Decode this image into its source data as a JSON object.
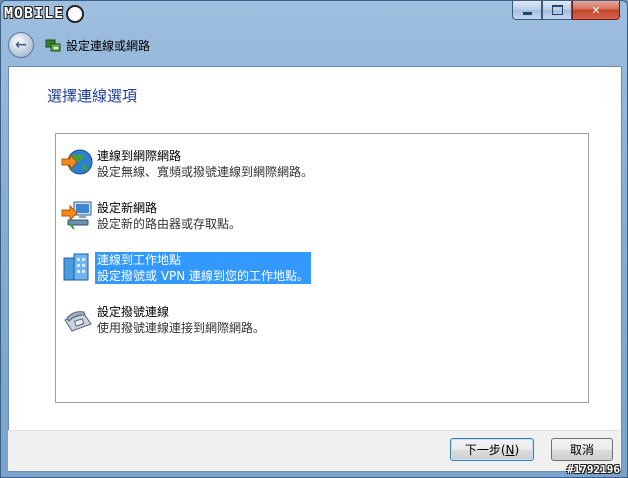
{
  "watermark": {
    "text": "MOBILE",
    "tag": "#1792196"
  },
  "window": {
    "title": "設定連線或網路",
    "controls": {
      "minimize": "minimize",
      "maximize": "maximize",
      "close": "✕"
    }
  },
  "page": {
    "heading": "選擇連線選項"
  },
  "options": [
    {
      "title": "連線到網際網路",
      "desc": "設定無線、寬頻或撥號連線到網際網路。",
      "icon": "globe-connect-icon",
      "selected": false
    },
    {
      "title": "設定新網路",
      "desc": "設定新的路由器或存取點。",
      "icon": "new-network-icon",
      "selected": false
    },
    {
      "title": "連線到工作地點",
      "desc": "設定撥號或 VPN 連線到您的工作地點。",
      "icon": "workplace-building-icon",
      "selected": true
    },
    {
      "title": "設定撥號連線",
      "desc": "使用撥號連線連接到網際網路。",
      "icon": "dialup-phone-icon",
      "selected": false
    }
  ],
  "buttons": {
    "next_prefix": "下一步(",
    "next_key": "N",
    "next_suffix": ")",
    "cancel": "取消"
  },
  "colors": {
    "selection": "#3399ff",
    "heading": "#1e3f9a",
    "frame": "#87aed3"
  }
}
